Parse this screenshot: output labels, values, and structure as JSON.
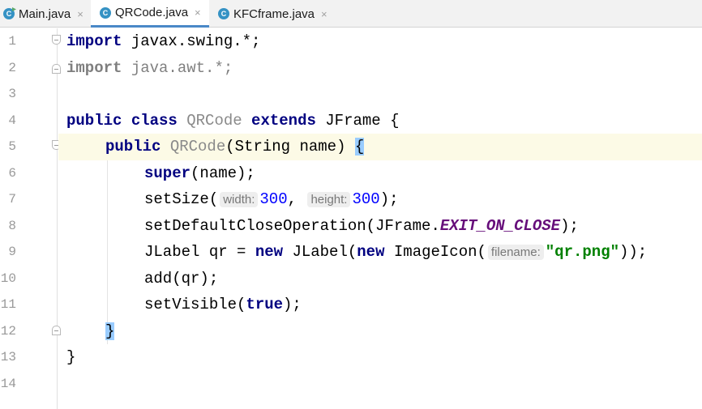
{
  "tabs": [
    {
      "label": "Main.java",
      "icon": "java-class-main-icon",
      "active": false
    },
    {
      "label": "QRCode.java",
      "icon": "java-class-icon",
      "active": true
    },
    {
      "label": "KFCframe.java",
      "icon": "java-class-icon",
      "active": false
    }
  ],
  "tab_close_glyph": "×",
  "class_icon_glyph": "C",
  "line_numbers": [
    "1",
    "2",
    "3",
    "4",
    "5",
    "6",
    "7",
    "8",
    "9",
    "10",
    "11",
    "12",
    "13",
    "14"
  ],
  "code": {
    "l1": {
      "kw": "import",
      "rest": " javax.swing.*;"
    },
    "l2": {
      "kw": "import",
      "rest": " java.awt.*;"
    },
    "l4": {
      "kw1": "public class ",
      "cls": "QRCode",
      "kw2": " extends ",
      "rest": "JFrame {"
    },
    "l5": {
      "kw": "public ",
      "cls": "QRCode",
      "rest": "(String name) ",
      "brace": "{"
    },
    "l6": {
      "kw": "super",
      "rest": "(name);"
    },
    "l7": {
      "fn": "setSize(",
      "hint1": "width:",
      "v1": "300",
      "sep": ", ",
      "hint2": "height:",
      "v2": "300",
      "end": ");"
    },
    "l8": {
      "fn": "setDefaultCloseOperation(JFrame.",
      "const": "EXIT_ON_CLOSE",
      "end": ");"
    },
    "l9": {
      "a": "JLabel qr = ",
      "kw1": "new",
      "b": " JLabel(",
      "kw2": "new",
      "c": " ImageIcon(",
      "hint": "filename:",
      "str": "\"qr.png\"",
      "end": "));"
    },
    "l10": {
      "text": "add(qr);"
    },
    "l11": {
      "fn": "setVisible(",
      "kw": "true",
      "end": ");"
    },
    "l12": {
      "brace": "}"
    },
    "l13": {
      "text": "}"
    }
  },
  "colors": {
    "keyword": "#000080",
    "number": "#0000ff",
    "string": "#008000",
    "constant": "#660e7a",
    "current_line": "#fcfae6",
    "brace_match": "#99ccff"
  }
}
